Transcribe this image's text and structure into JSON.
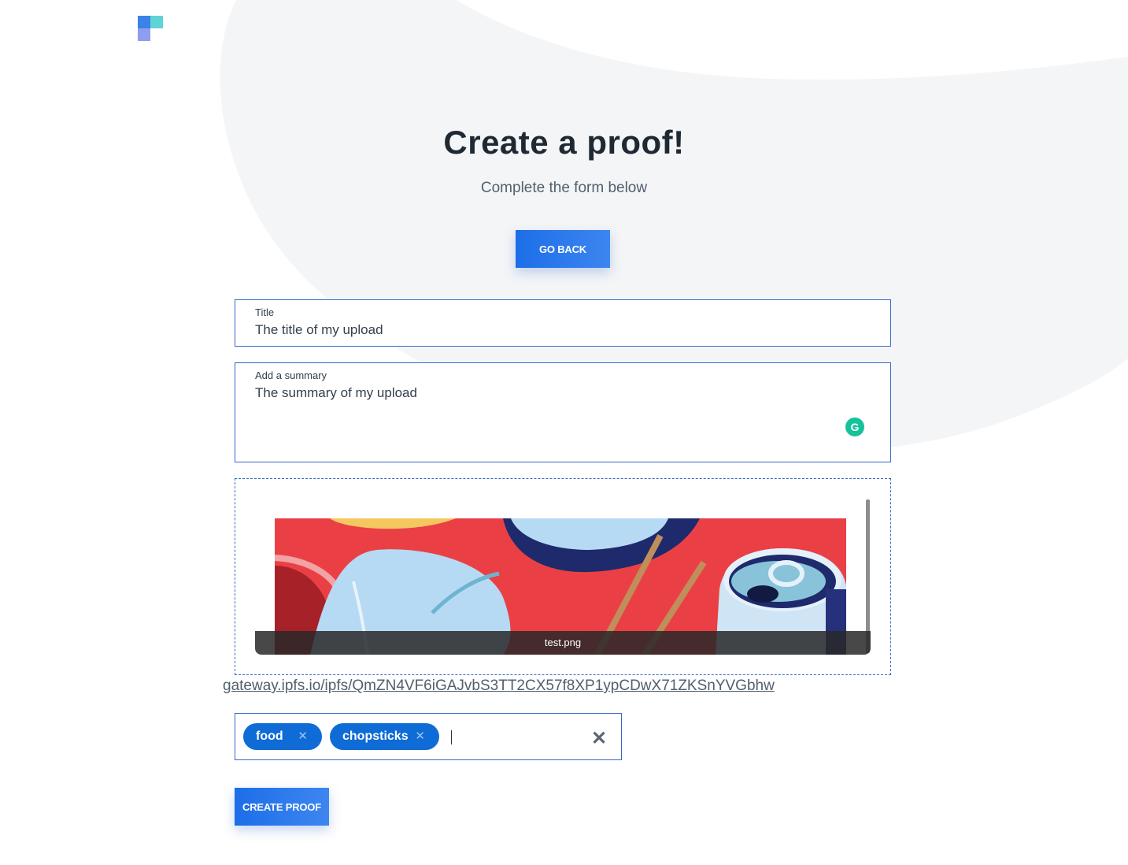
{
  "header": {
    "title": "Create a proof!",
    "subtitle": "Complete the form below",
    "go_back_label": "GO BACK"
  },
  "form": {
    "title_field": {
      "label": "Title",
      "value": "The title of my upload"
    },
    "summary_field": {
      "label": "Add a summary",
      "value": "The summary of my upload",
      "assistant_icon": "grammarly-icon"
    },
    "upload": {
      "filename": "test.png"
    },
    "ipfs_link": "gateway.ipfs.io/ipfs/QmZN4VF6iGAJvbS3TT2CX57f8XP1ypCDwX71ZKSnYVGbhw",
    "tags": [
      {
        "label": "food",
        "remove": "✕"
      },
      {
        "label": "chopsticks",
        "remove": "✕"
      }
    ],
    "clear_tags": "✕",
    "submit_label": "CREATE PROOF"
  },
  "colors": {
    "primary": "#1c6ee8",
    "tag": "#0f6bd6",
    "border": "#3569c9",
    "background_shape": "#f4f5f7"
  }
}
